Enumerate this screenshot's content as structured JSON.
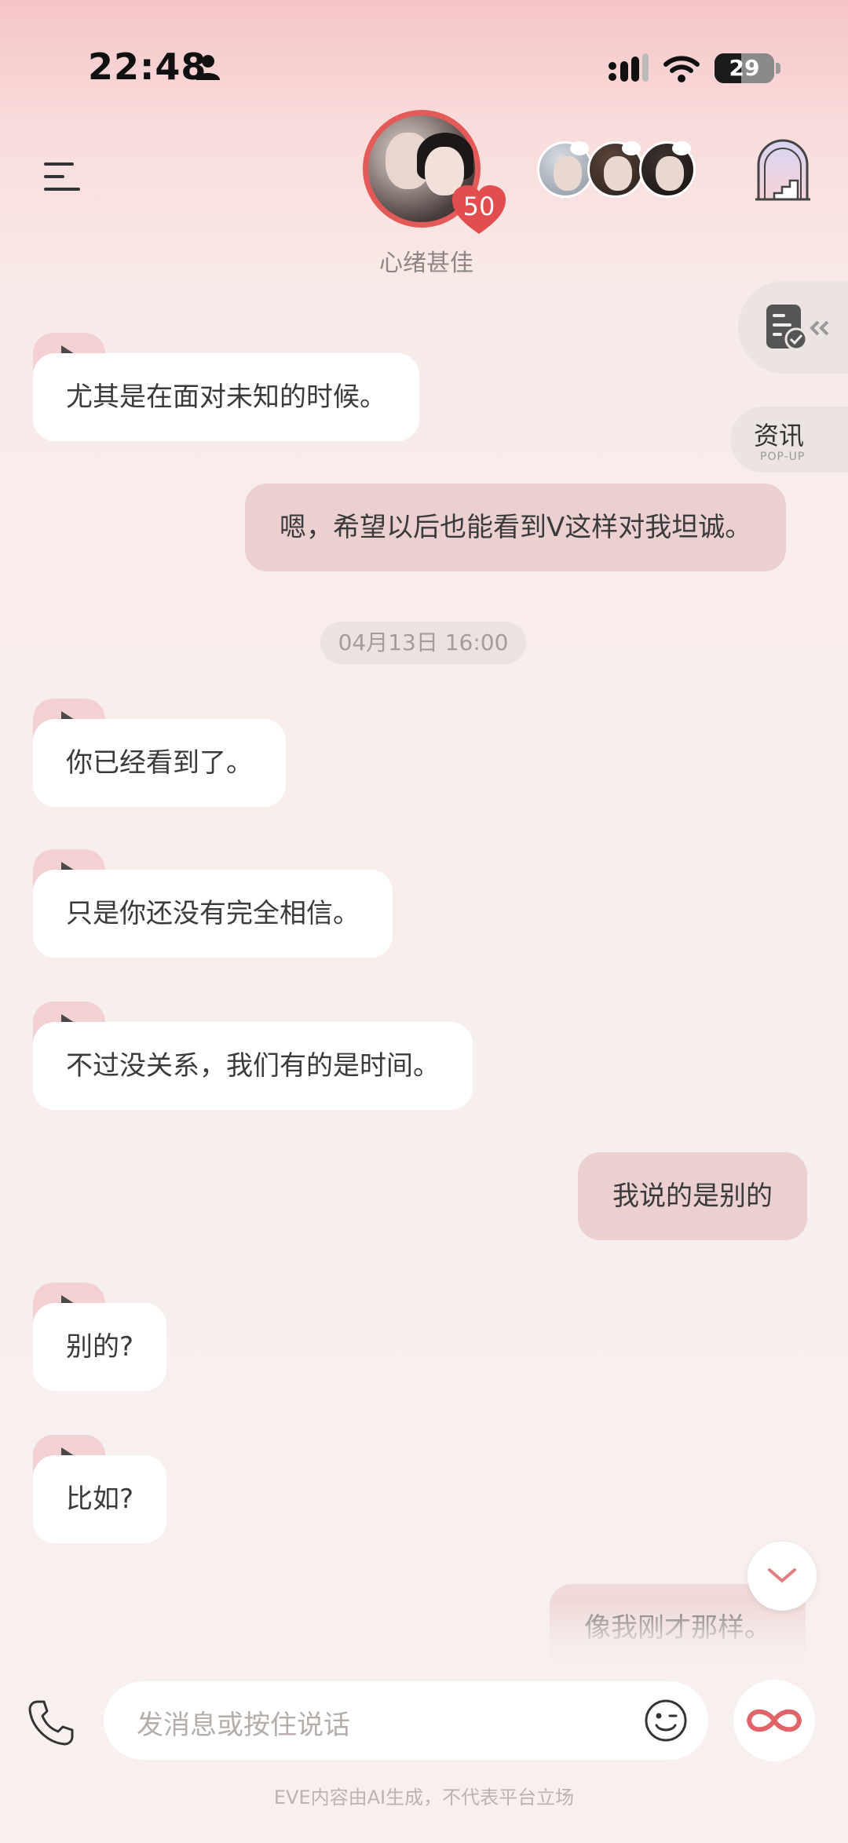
{
  "status_bar": {
    "time": "22:48",
    "battery": "29"
  },
  "header": {
    "intimacy": "50",
    "mood": "心绪甚佳"
  },
  "side": {
    "news_label": "资讯",
    "news_sub": "POP-UP"
  },
  "messages": [
    {
      "from": "ai",
      "text": "尤其是在面对未知的时候。"
    },
    {
      "from": "user",
      "text": "嗯，希望以后也能看到V这样对我坦诚。"
    },
    {
      "from": "ai",
      "text": "你已经看到了。"
    },
    {
      "from": "ai",
      "text": "只是你还没有完全相信。"
    },
    {
      "from": "ai",
      "text": "不过没关系，我们有的是时间。"
    },
    {
      "from": "user",
      "text": "我说的是别的"
    },
    {
      "from": "ai",
      "text": "别的?"
    },
    {
      "from": "ai",
      "text": "比如?"
    },
    {
      "from": "user",
      "text": "像我刚才那样。"
    }
  ],
  "timestamp": "04月13日 16:00",
  "input": {
    "placeholder": "发消息或按住说话"
  },
  "disclaimer": "EVE内容由AI生成，不代表平台立场",
  "colors": {
    "accent": "#e45a58",
    "user_bubble": "#ecd0d0",
    "ai_bubble": "#ffffff"
  }
}
